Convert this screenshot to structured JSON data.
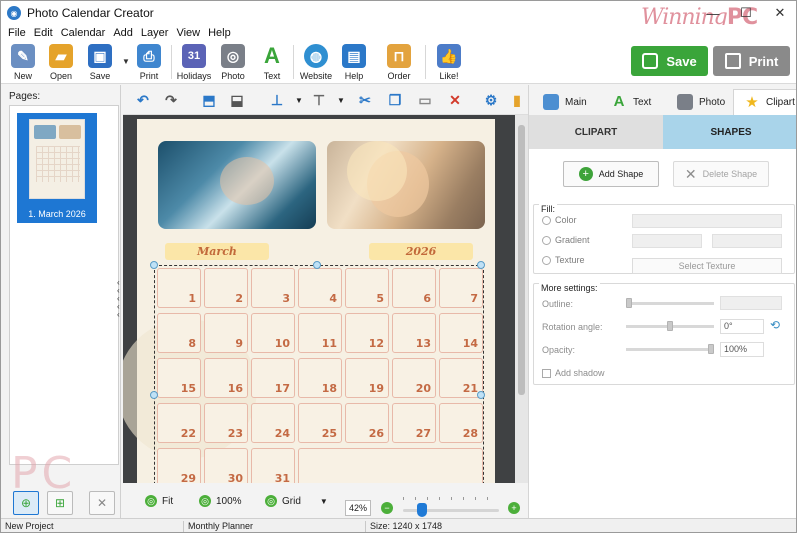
{
  "window": {
    "title": "Photo Calendar Creator",
    "watermark_text": "Winning",
    "watermark_bold": "PC",
    "controls": {
      "minimize": "—",
      "maximize": "☐",
      "close": "✕"
    }
  },
  "menu": [
    "File",
    "Edit",
    "Calendar",
    "Add",
    "Layer",
    "View",
    "Help"
  ],
  "toolbar": {
    "buttons": [
      {
        "label": "New",
        "icon": "new-document-icon",
        "color": "#6b8fc2"
      },
      {
        "label": "Open",
        "icon": "folder-open-icon",
        "color": "#e5a32b"
      },
      {
        "label": "Save",
        "icon": "floppy-disk-icon",
        "color": "#2e6fc2"
      },
      {
        "label": "Print",
        "icon": "printer-icon",
        "color": "#3f86cf"
      },
      {
        "label": "Holidays",
        "icon": "calendar-31-icon",
        "color": "#5b63b6"
      },
      {
        "label": "Photo",
        "icon": "camera-icon",
        "color": "#7a7f88"
      },
      {
        "label": "Text",
        "icon": "text-a-icon",
        "color": "#3aa53a"
      },
      {
        "label": "Website",
        "icon": "globe-icon",
        "color": "#2f8fd1"
      },
      {
        "label": "Help",
        "icon": "book-icon",
        "color": "#2b78c8"
      },
      {
        "label": "Order",
        "icon": "shopping-bag-icon",
        "color": "#e3a33e"
      },
      {
        "label": "Like!",
        "icon": "thumbs-up-icon",
        "color": "#4d7cc8"
      }
    ],
    "save_label": "Save",
    "print_label": "Print",
    "save_color": "#3aa53a",
    "print_color": "#8a8a8a"
  },
  "pages": {
    "label": "Pages:",
    "items": [
      {
        "label": "1. March 2026"
      }
    ],
    "logo_text": "PC"
  },
  "canvas": {
    "month": "March",
    "year": "2026",
    "days": [
      "1",
      "2",
      "3",
      "4",
      "5",
      "6",
      "7",
      "8",
      "9",
      "10",
      "11",
      "12",
      "13",
      "14",
      "15",
      "16",
      "17",
      "18",
      "19",
      "20",
      "21",
      "22",
      "23",
      "24",
      "25",
      "26",
      "27",
      "28",
      "29",
      "30",
      "31"
    ]
  },
  "zoom": {
    "fit_label": "Fit",
    "hundred_label": "100%",
    "grid_label": "Grid",
    "zoom_value": "42%",
    "zoom_level_fraction": 0.2
  },
  "right_panel": {
    "tabs": [
      {
        "label": "Main",
        "icon": "main-layout-icon"
      },
      {
        "label": "Text",
        "icon": "text-a-icon"
      },
      {
        "label": "Photo",
        "icon": "camera-icon"
      },
      {
        "label": "Clipart",
        "icon": "star-icon"
      }
    ],
    "subtabs": [
      "CLIPART",
      "SHAPES"
    ],
    "add_shape": "Add Shape",
    "delete_shape": "Delete Shape",
    "fill": {
      "title": "Fill:",
      "options": [
        "Color",
        "Gradient",
        "Texture"
      ],
      "select_texture": "Select Texture"
    },
    "more": {
      "title": "More settings:",
      "outline": "Outline:",
      "rotation": "Rotation angle:",
      "rotation_value": "0°",
      "opacity": "Opacity:",
      "opacity_value": "100%",
      "shadow": "Add shadow"
    }
  },
  "status": {
    "project": "New Project",
    "planner": "Monthly Planner",
    "size": "Size: 1240 x 1748"
  }
}
